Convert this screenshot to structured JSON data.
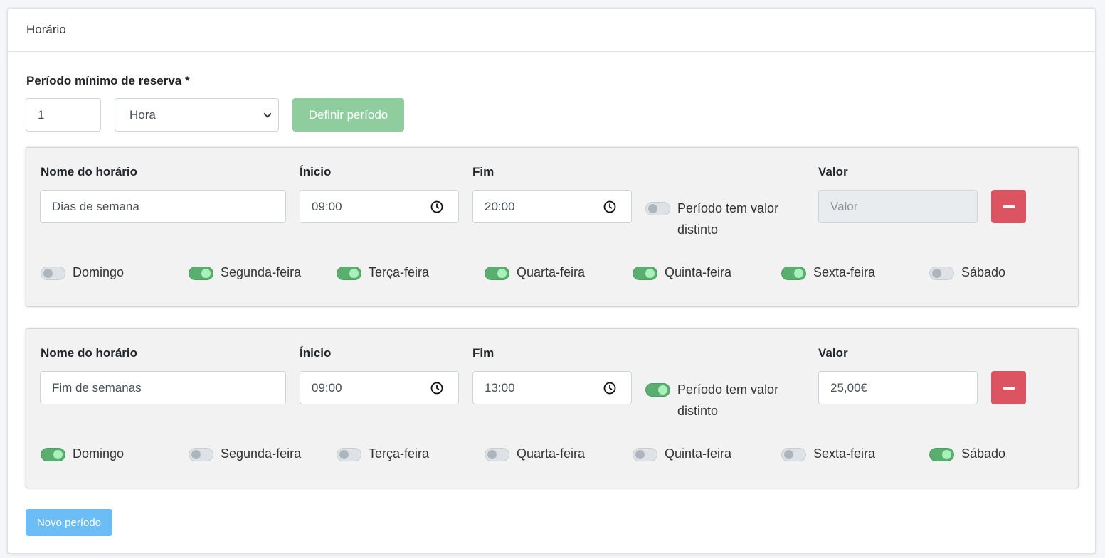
{
  "card": {
    "title": "Horário"
  },
  "minimum": {
    "label": "Período mínimo de reserva *",
    "quantity": "1",
    "unit": "Hora",
    "define_button": "Definir período"
  },
  "labels": {
    "name": "Nome do horário",
    "start": "Ínicio",
    "end": "Fim",
    "value": "Valor",
    "distinct_line1": "Período tem valor",
    "distinct_line2": "distinto",
    "value_placeholder": "Valor"
  },
  "days": [
    "Domingo",
    "Segunda-feira",
    "Terça-feira",
    "Quarta-feira",
    "Quinta-feira",
    "Sexta-feira",
    "Sábado"
  ],
  "schedules": [
    {
      "name": "Dias de semana",
      "start": "09:00",
      "end": "20:00",
      "distinct_value": false,
      "value": "",
      "days_on": [
        false,
        true,
        true,
        true,
        true,
        true,
        false
      ]
    },
    {
      "name": "Fim de semanas",
      "start": "09:00",
      "end": "13:00",
      "distinct_value": true,
      "value": "25,00€",
      "days_on": [
        true,
        false,
        false,
        false,
        false,
        false,
        true
      ]
    }
  ],
  "new_button": "Novo período",
  "colors": {
    "toggle_on": "#5aae6f",
    "remove_button": "#dc5462",
    "define_button": "#8fcd9f",
    "new_button": "#6cbcf5"
  }
}
